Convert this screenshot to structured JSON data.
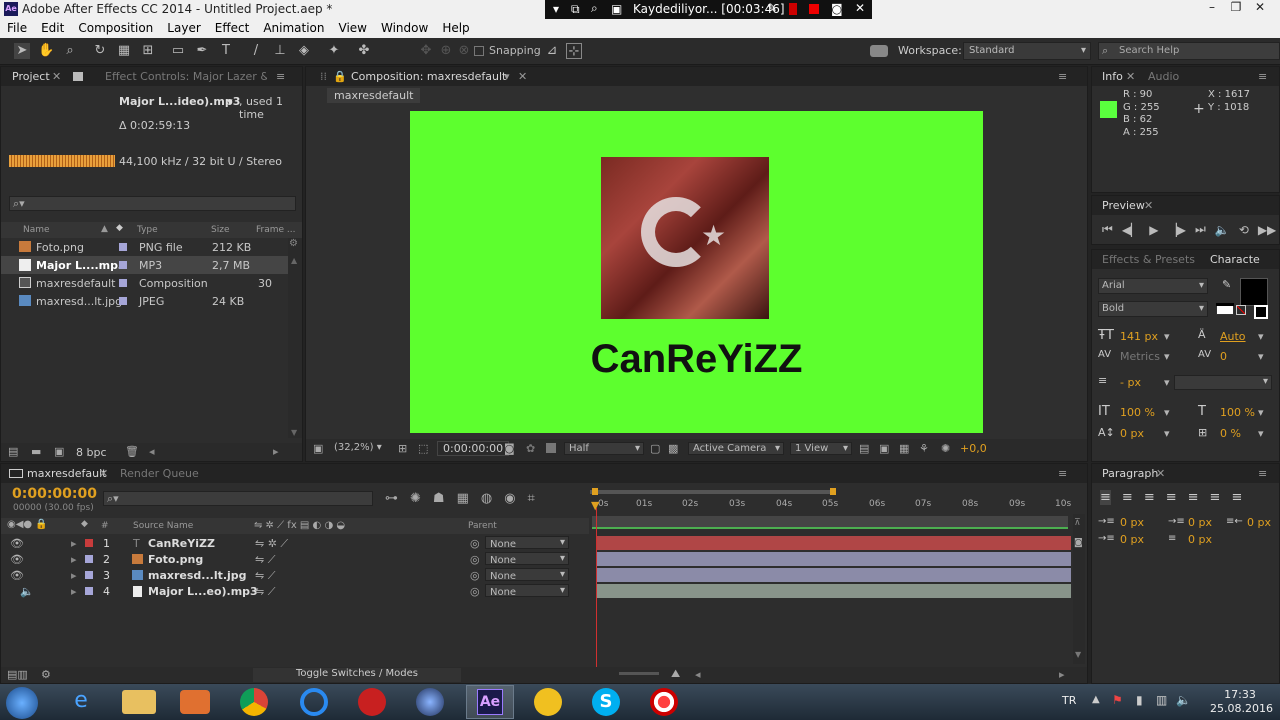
{
  "window": {
    "title": "Adobe After Effects CC 2014 - Untitled Project.aep *",
    "app_icon": "Ae"
  },
  "recorder": {
    "status": "Kaydediliyor... [00:03:46]"
  },
  "menu": [
    "File",
    "Edit",
    "Composition",
    "Layer",
    "Effect",
    "Animation",
    "View",
    "Window",
    "Help"
  ],
  "toolbar": {
    "snapping": "Snapping",
    "workspace_label": "Workspace:",
    "workspace_value": "Standard",
    "search_placeholder": "Search Help"
  },
  "project_panel": {
    "tab_project": "Project",
    "tab_effect_controls": "Effect Controls: Major Lazer & DJ",
    "selected_name": "Major L...ideo).mp3",
    "used": ", used 1 time",
    "duration": "Δ 0:02:59:13",
    "audio_info": "44,100 kHz / 32 bit U / Stereo",
    "columns": [
      "Name",
      "Type",
      "Size",
      "Frame ..."
    ],
    "items": [
      {
        "name": "Foto.png",
        "type": "PNG file",
        "size": "212 KB",
        "frame": "",
        "color": "#a6a6d8",
        "icon": "image-icon"
      },
      {
        "name": "Major L....mp3",
        "type": "MP3",
        "size": "2,7 MB",
        "frame": "",
        "color": "#a6a6d8",
        "icon": "audio-file-icon"
      },
      {
        "name": "maxresdefault",
        "type": "Composition",
        "size": "",
        "frame": "30",
        "color": "#a6a6d8",
        "icon": "composition-icon"
      },
      {
        "name": "maxresd...lt.jpg",
        "type": "JPEG",
        "size": "24 KB",
        "frame": "",
        "color": "#a6a6d8",
        "icon": "image-icon"
      }
    ],
    "bpc": "8 bpc"
  },
  "composition": {
    "tab": "Composition: maxresdefault",
    "breadcrumb": "maxresdefault",
    "canvas_text": "CanReYiZZ",
    "background": "#5dff2e",
    "zoom": "(32,2%)",
    "timecode": "0:00:00:00",
    "resolution": "Half",
    "camera": "Active Camera",
    "views": "1 View",
    "exposure": "+0,0"
  },
  "info_panel": {
    "tab_info": "Info",
    "tab_audio": "Audio",
    "r": "R : 90",
    "g": "G : 255",
    "b": "B : 62",
    "a": "A : 255",
    "x": "X : 1617",
    "y": "Y : 1018",
    "swatch": "#5aff3e"
  },
  "preview_panel": {
    "tab": "Preview"
  },
  "character_panel": {
    "tab_effects": "Effects & Presets",
    "tab_character": "Characte",
    "font": "Arial",
    "style": "Bold",
    "size": "141 px",
    "leading": "Auto",
    "kerning": "Metrics",
    "tracking": "0",
    "stroke": "- px",
    "v_scale": "100 %",
    "h_scale": "100 %",
    "baseline": "0 px",
    "tsume": "0 %"
  },
  "timeline": {
    "tab_comp": "maxresdefault",
    "tab_render": "Render Queue",
    "timecode": "0:00:00:00",
    "fps": "00000 (30.00 fps)",
    "col_source": "Source Name",
    "col_parent": "Parent",
    "ruler": [
      "0s",
      "01s",
      "02s",
      "03s",
      "04s",
      "05s",
      "06s",
      "07s",
      "08s",
      "09s",
      "10s"
    ],
    "layers": [
      {
        "num": "1",
        "name": "CanReYiZZ",
        "parent": "None",
        "color": "#c83c3c",
        "bar": "#b04646",
        "icon": "text-layer-icon"
      },
      {
        "num": "2",
        "name": "Foto.png",
        "parent": "None",
        "color": "#a6a6d8",
        "bar": "#8b8ba8",
        "icon": "image-icon"
      },
      {
        "num": "3",
        "name": "maxresd...lt.jpg",
        "parent": "None",
        "color": "#a6a6d8",
        "bar": "#8b8ba8",
        "icon": "image-icon"
      },
      {
        "num": "4",
        "name": "Major L...eo).mp3",
        "parent": "None",
        "color": "#a6a6d8",
        "bar": "#88948a",
        "icon": "audio-file-icon"
      }
    ],
    "toggle": "Toggle Switches / Modes"
  },
  "paragraph_panel": {
    "tab": "Paragraph",
    "indent_left": "0 px",
    "indent_right": "0 px",
    "first_line": "0 px",
    "space_before": "0 px",
    "space_after": "0 px"
  },
  "taskbar": {
    "lang": "TR",
    "time": "17:33",
    "date": "25.08.2016",
    "ae_label": "Ae"
  }
}
